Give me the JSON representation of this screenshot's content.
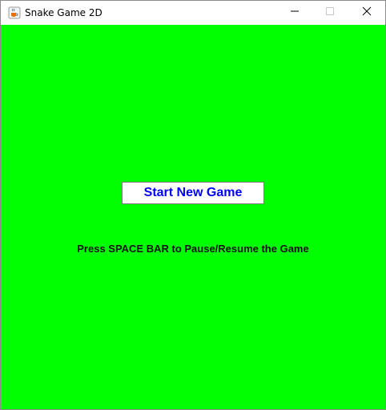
{
  "window": {
    "title": "Snake Game 2D",
    "app_icon": "java-cup-icon",
    "controls": {
      "minimize_icon": "minimize-icon",
      "maximize_icon": "maximize-icon",
      "close_icon": "close-icon"
    }
  },
  "game": {
    "background_color": "#00ff00",
    "start_button_label": "Start New Game",
    "start_button_text_color": "#0000ff",
    "hint": "Press SPACE BAR to Pause/Resume the Game"
  }
}
